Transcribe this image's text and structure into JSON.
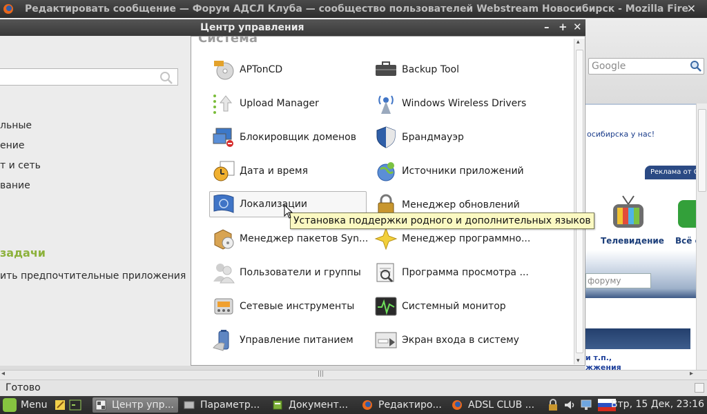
{
  "firefox": {
    "title": "Редактировать сообщение — Форум АДСЛ Клуба — сообщество пользователей Webstream Новосибирск - Mozilla Fire",
    "close_glyph": "✕",
    "search_placeholder": "Google",
    "content": {
      "region_text": "осибирска у нас!",
      "ad_label": "Реклама от G",
      "tv_label": "Телевидение",
      "all_label": "Всё с",
      "forum_input": "форуму",
      "links": [
        "и т.п.,",
        "жжения"
      ]
    },
    "status": "Готово"
  },
  "control_center": {
    "title": "Центр управления",
    "buttons": {
      "minimize": "–",
      "maximize": "+",
      "close": "✕"
    },
    "left_nav": [
      "льные",
      "ение",
      "т и сеть",
      "вание"
    ],
    "tasks_heading": "задачи",
    "pref_apps": "ить предпочтительные приложения",
    "section_title": "Система",
    "applets": [
      {
        "label": "APTonCD",
        "icon": "aptoncd-icon"
      },
      {
        "label": "Backup Tool",
        "icon": "backup-tool-icon"
      },
      {
        "label": "Upload Manager",
        "icon": "upload-manager-icon"
      },
      {
        "label": "Windows Wireless Drivers",
        "icon": "wireless-drivers-icon"
      },
      {
        "label": "Блокировщик доменов",
        "icon": "domain-blocker-icon"
      },
      {
        "label": "Брандмауэр",
        "icon": "firewall-icon"
      },
      {
        "label": "Дата и время",
        "icon": "date-time-icon"
      },
      {
        "label": "Источники приложений",
        "icon": "software-sources-icon"
      },
      {
        "label": "Локализации",
        "icon": "localization-icon"
      },
      {
        "label": "Менеджер обновлений",
        "icon": "update-manager-icon"
      },
      {
        "label": "Менеджер пакетов Syn...",
        "icon": "synaptic-icon"
      },
      {
        "label": "Менеджер программно...",
        "icon": "software-manager-icon"
      },
      {
        "label": "Пользователи и группы",
        "icon": "users-groups-icon"
      },
      {
        "label": "Программа просмотра ...",
        "icon": "log-viewer-icon"
      },
      {
        "label": "Сетевые инструменты",
        "icon": "network-tools-icon"
      },
      {
        "label": "Системный монитор",
        "icon": "system-monitor-icon"
      },
      {
        "label": "Управление питанием",
        "icon": "power-management-icon"
      },
      {
        "label": "Экран входа в систему",
        "icon": "login-screen-icon"
      }
    ],
    "tooltip": "Установка поддержки родного и дополнительных языков"
  },
  "taskbar": {
    "menu_label": "Menu",
    "tasks": [
      {
        "label": "Центр упр...",
        "active": true
      },
      {
        "label": "Параметр...",
        "active": false
      },
      {
        "label": "Документ...",
        "active": false
      },
      {
        "label": "Редактиро...",
        "active": false
      },
      {
        "label": "ADSL CLUB ...",
        "active": false
      }
    ],
    "clock": "Втр, 15 Дек, 23:16"
  },
  "colors": {
    "accent_green": "#8cb13b",
    "tooltip_bg": "#fbf9c2",
    "taskbar_bg": "#2f2f2f",
    "titlebar_bg": "#3e3e3e"
  }
}
